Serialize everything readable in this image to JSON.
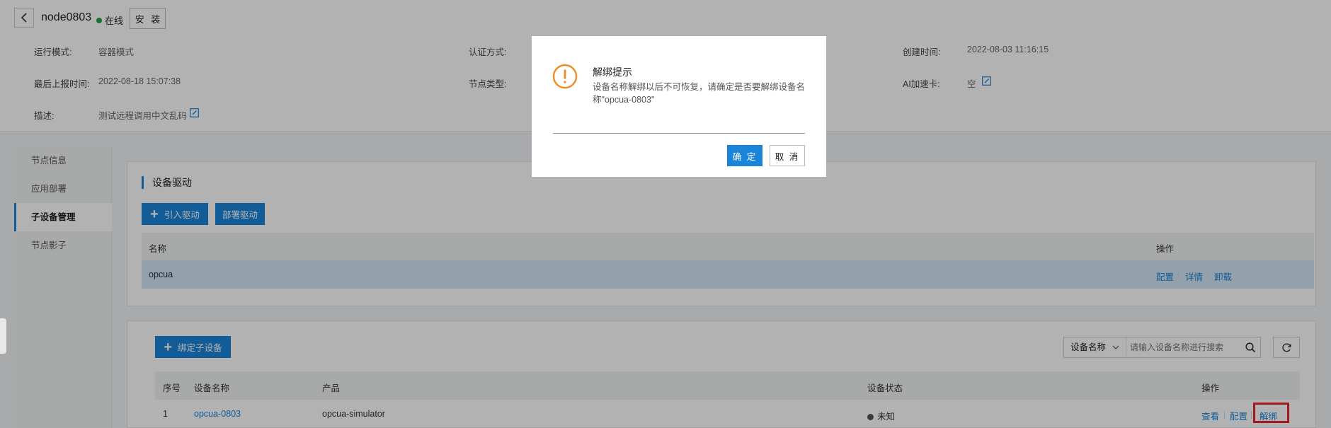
{
  "header": {
    "node_name": "node0803",
    "status": "在线",
    "status_color": "#22a84a",
    "install_label": "安 装",
    "fields": {
      "run_mode_label": "运行模式:",
      "run_mode_value": "容器模式",
      "auth_label": "认证方式:",
      "created_label": "创建时间:",
      "created_value": "2022-08-03 11:16:15",
      "last_report_label": "最后上报时间:",
      "last_report_value": "2022-08-18 15:07:38",
      "node_type_label": "节点类型:",
      "ai_label": "AI加速卡:",
      "ai_value": "空",
      "desc_label": "描述:",
      "desc_value": "测试远程调用中文乱码"
    }
  },
  "sidebar": {
    "items": [
      {
        "label": "节点信息"
      },
      {
        "label": "应用部署"
      },
      {
        "label": "子设备管理"
      },
      {
        "label": "节点影子"
      }
    ]
  },
  "driver": {
    "title": "设备驱动",
    "import_label": "引入驱动",
    "deploy_label": "部署驱动",
    "col_name": "名称",
    "col_ops": "操作",
    "rows": [
      {
        "name": "opcua",
        "op_config": "配置",
        "op_detail": "详情",
        "op_uninstall": "卸载"
      }
    ]
  },
  "subdevice": {
    "bind_label": "绑定子设备",
    "search_select": "设备名称",
    "search_placeholder": "请输入设备名称进行搜索",
    "cols": {
      "index": "序号",
      "name": "设备名称",
      "product": "产品",
      "status": "设备状态",
      "ops": "操作"
    },
    "rows": [
      {
        "index": "1",
        "name": "opcua-0803",
        "product": "opcua-simulator",
        "status": "未知",
        "op_view": "查看",
        "op_config": "配置",
        "op_unbind": "解绑"
      }
    ]
  },
  "modal": {
    "title": "解绑提示",
    "message": "设备名称解绑以后不可恢复，请确定是否要解绑设备名称\"opcua-0803\"",
    "ok_label": "确 定",
    "cancel_label": "取 消",
    "icon_color": "#f08a24"
  },
  "colors": {
    "accent": "#1a84d9",
    "highlight": "#e4242b"
  }
}
